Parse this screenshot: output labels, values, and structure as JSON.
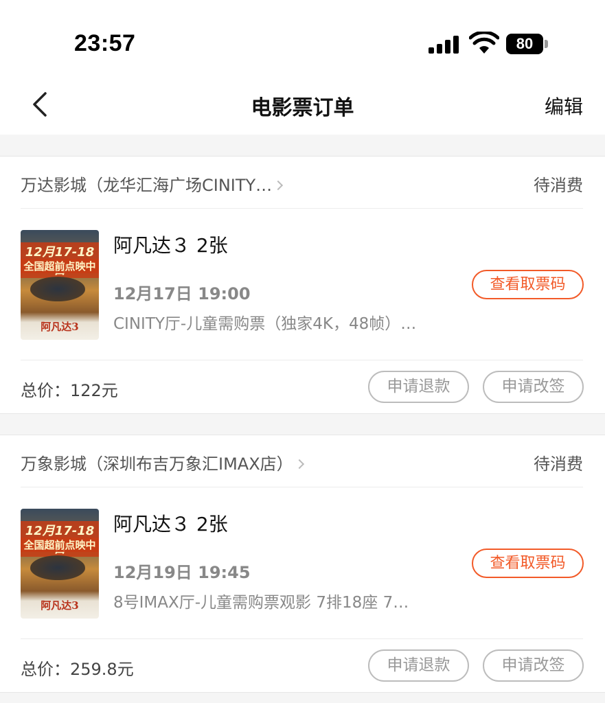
{
  "status_bar": {
    "time": "23:57",
    "battery": "80"
  },
  "nav": {
    "title": "电影票订单",
    "edit_label": "编辑"
  },
  "orders": [
    {
      "cinema": "万达影城（龙华汇海广场CINITY…",
      "status": "待消费",
      "poster": {
        "date_line": "12月17-18日",
        "promo_line": "全国超前点映中",
        "title_line": "阿凡达3"
      },
      "movie": "阿凡达３ 2张",
      "showtime": "12月17日 19:00",
      "hall": "CINITY厅-儿童需购票（独家4K，48帧）…",
      "qr_label": "查看取票码",
      "total": "总价：122元",
      "refund_label": "申请退款",
      "change_label": "申请改签"
    },
    {
      "cinema": "万象影城（深圳布吉万象汇IMAX店）",
      "status": "待消费",
      "poster": {
        "date_line": "12月17-18日",
        "promo_line": "全国超前点映中",
        "title_line": "阿凡达3"
      },
      "movie": "阿凡达３ 2张",
      "showtime": "12月19日 19:45",
      "hall": "8号IMAX厅-儿童需购票观影 7排18座 7…",
      "qr_label": "查看取票码",
      "total": "总价：259.8元",
      "refund_label": "申请退款",
      "change_label": "申请改签"
    }
  ]
}
